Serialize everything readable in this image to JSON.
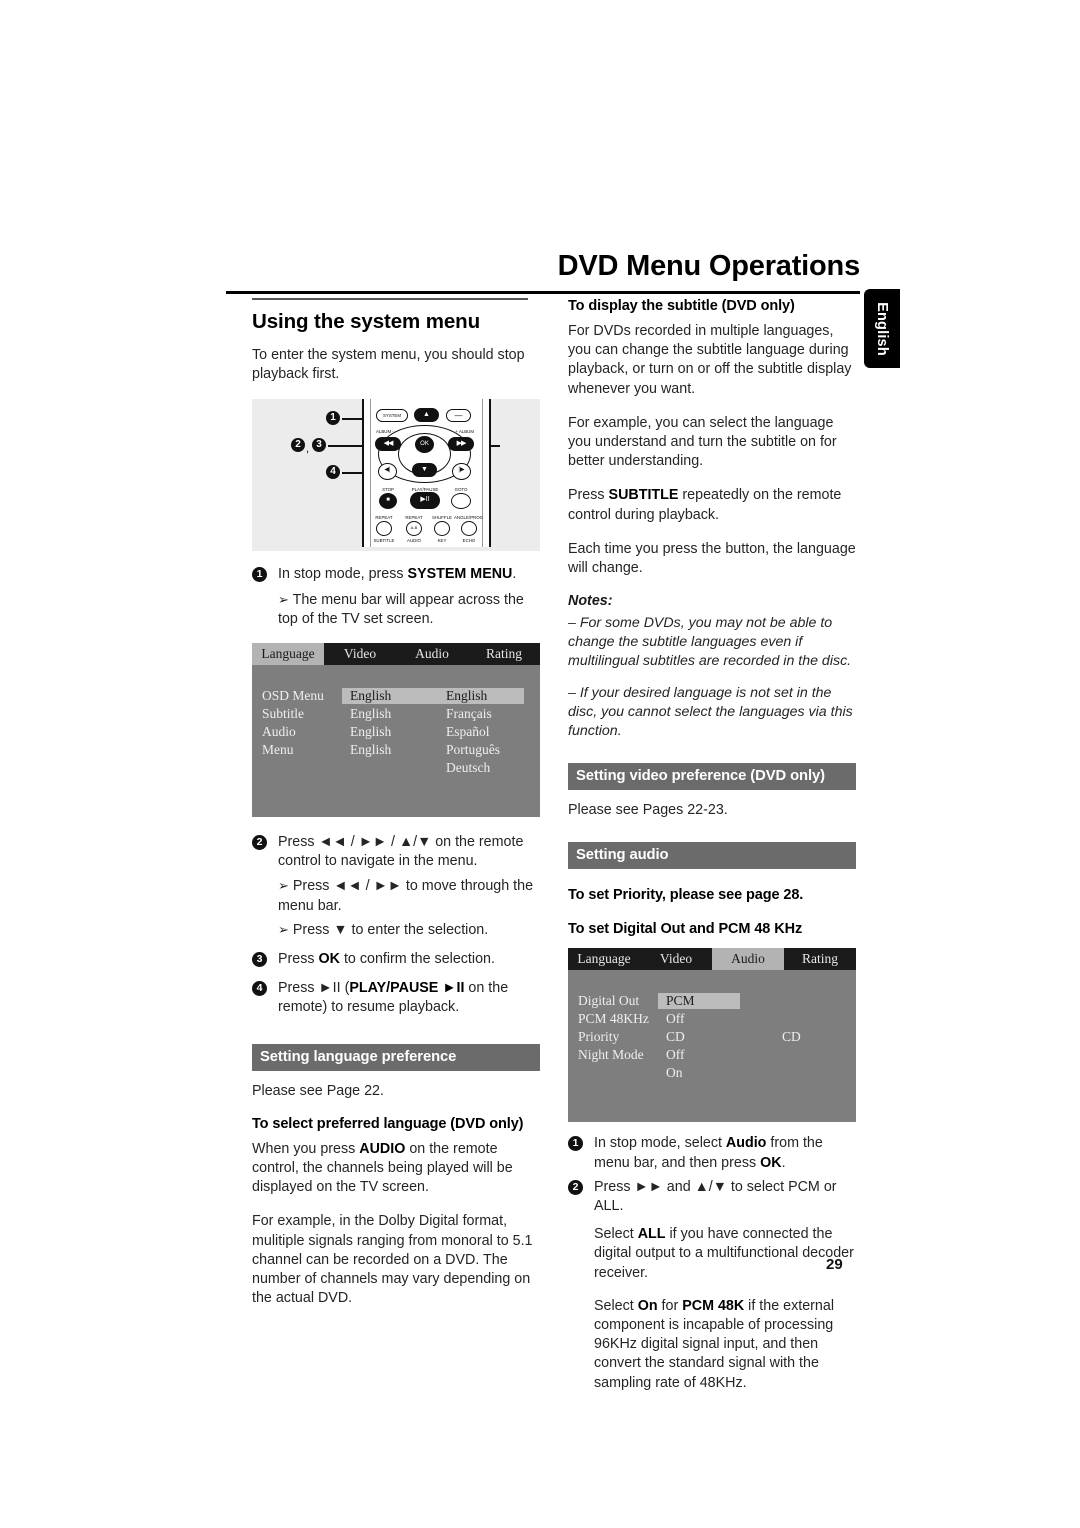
{
  "page": {
    "chapter_title": "DVD Menu Operations",
    "language_tab": "English",
    "page_number": "29"
  },
  "left_column": {
    "section_title": "Using the system menu",
    "intro": "To enter the system menu, you should stop playback first.",
    "remote_callouts": [
      "1",
      "2",
      "3",
      "4"
    ],
    "remote_buttons": {
      "system": "SYSTEM",
      "album_minus": "ALBUM -",
      "album_plus": "+ ALBUM",
      "ok": "OK",
      "stop": "STOP",
      "play_pause": "PLAY/PAUSE",
      "goto": "GOTO",
      "repeat": "REPEAT",
      "repeat_ab": "REPEAT",
      "repeat_ab_inner": "A-B",
      "shuffle": "SHUFFLE",
      "angle_prog": "ANGLE/PROG",
      "subtitle": "SUBTITLE",
      "audio": "AUDIO",
      "key": "KEY",
      "echo": "ECHO"
    },
    "step1": {
      "num": "1",
      "text_before": "In stop mode, press ",
      "bold": "SYSTEM MENU",
      "text_after": ".",
      "arrow_line": "The menu bar will appear across the top of the TV set screen."
    },
    "osd_language": {
      "tabs": [
        "Language",
        "Video",
        "Audio",
        "Rating"
      ],
      "active_tab": "Language",
      "rows": [
        {
          "label": "OSD Menu",
          "value": "English",
          "value_selected": true,
          "option": "English",
          "option_selected": true
        },
        {
          "label": "Subtitle",
          "value": "English",
          "value_selected": false,
          "option": "Français",
          "option_selected": false
        },
        {
          "label": "Audio",
          "value": "English",
          "value_selected": false,
          "option": "Español",
          "option_selected": false
        },
        {
          "label": "Menu",
          "value": "English",
          "value_selected": false,
          "option": "Português",
          "option_selected": false
        },
        {
          "label": "",
          "value": "",
          "value_selected": false,
          "option": "Deutsch",
          "option_selected": false
        }
      ]
    },
    "step2": {
      "num": "2",
      "line1": "Press ◄◄ / ►► / ▲/▼ on the remote control to navigate in the menu.",
      "sub1": "Press ◄◄ / ►► to move through the menu bar.",
      "sub2": "Press ▼ to enter the selection."
    },
    "step3": {
      "num": "3",
      "before": "Press ",
      "bold": "OK",
      "after": " to confirm the selection."
    },
    "step4": {
      "num": "4",
      "before": "Press ►II (",
      "bold": "PLAY/PAUSE ►II",
      "after": " on the remote) to resume playback."
    },
    "language_pref": {
      "heading": "Setting language preference",
      "see_page": "Please see Page 22.",
      "sub_head": "To select preferred language (DVD only)",
      "para1_before": "When you press ",
      "para1_bold": "AUDIO",
      "para1_after": " on the remote control, the channels being played will be displayed on the TV screen.",
      "para2": "For example, in the Dolby Digital format, mulitiple signals ranging from monoral to 5.1 channel can be recorded on a DVD. The number of channels may vary depending on the actual DVD."
    }
  },
  "right_column": {
    "subtitle_section": {
      "heading": "To display the subtitle (DVD only)",
      "para1": "For DVDs recorded in multiple languages, you can change  the subtitle language during playback, or turn on or off the subtitle display whenever you want.",
      "para2": "For example, you can select the language you understand and turn the subtitle on for better understanding.",
      "para3_before": "Press ",
      "para3_bold": "SUBTITLE",
      "para3_after": " repeatedly on the remote control during playback.",
      "para4": "Each time you press the button, the language will change."
    },
    "notes": {
      "label": "Notes:",
      "items": [
        "–  For some DVDs, you may not be able to change the subtitle languages even if multilingual subtitles are recorded in the disc.",
        "– If your desired language is not set in the disc, you cannot select the languages via this function."
      ]
    },
    "video_pref": {
      "heading": "Setting video preference (DVD only)",
      "body": "Please see Pages 22-23."
    },
    "setting_audio": {
      "heading": "Setting audio",
      "sub_head1": "To set Priority, please see page 28.",
      "sub_head2": "To set Digital Out and PCM 48 KHz"
    },
    "osd_audio": {
      "tabs": [
        "Language",
        "Video",
        "Audio",
        "Rating"
      ],
      "active_tab": "Audio",
      "rows": [
        {
          "label": "Digital Out",
          "value": "PCM",
          "value_selected": true,
          "option": "",
          "option_selected": false
        },
        {
          "label": "PCM 48KHz",
          "value": "Off",
          "value_selected": false,
          "option": "",
          "option_selected": false
        },
        {
          "label": "Priority",
          "value": "CD",
          "value_selected": false,
          "option": "CD",
          "option_selected": false
        },
        {
          "label": "Night Mode",
          "value": "Off",
          "value_selected": false,
          "option": "",
          "option_selected": false
        },
        {
          "label": "",
          "value": "On",
          "value_selected": false,
          "option": "",
          "option_selected": false
        }
      ]
    },
    "audio_steps": {
      "step1": {
        "num": "1",
        "before": "In stop mode, select ",
        "bold1": "Audio",
        "mid": " from the menu bar, and then press ",
        "bold2": "OK",
        "after": "."
      },
      "step2": {
        "num": "2",
        "line": "Press ►► and  ▲/▼ to select PCM or ALL."
      },
      "para_all_before": "Select ",
      "para_all_bold": "ALL",
      "para_all_after": " if you have connected the digital output to a multifunctional decoder receiver.",
      "para_on_before": "Select ",
      "para_on_bold1": "On",
      "para_on_mid": " for ",
      "para_on_bold2": "PCM 48K",
      "para_on_after": " if the external component is incapable of processing 96KHz digital signal input,  and then convert the standard signal with the sampling rate of 48KHz."
    }
  }
}
